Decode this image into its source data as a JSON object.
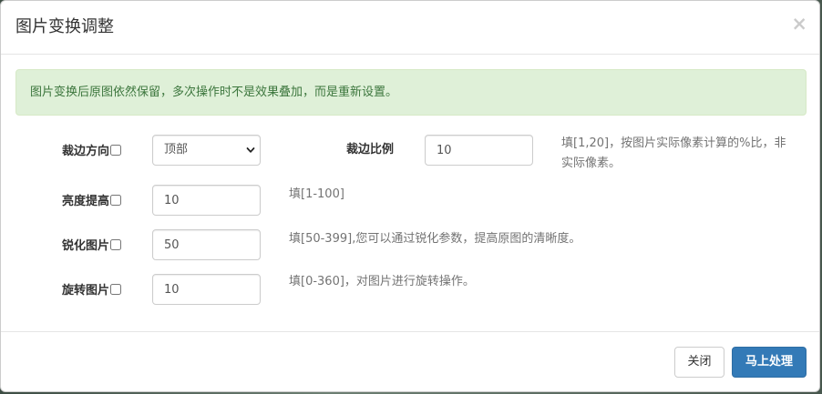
{
  "modal": {
    "title": "图片变换调整",
    "close_label": "×"
  },
  "alert": {
    "text": "图片变换后原图依然保留，多次操作时不是效果叠加，而是重新设置。"
  },
  "form": {
    "crop_direction": {
      "label": "裁边方向",
      "checked": false,
      "selected": "顶部"
    },
    "crop_ratio": {
      "label": "裁边比例",
      "value": "10",
      "help_line1": "填[1,20]，按图片实际像素计算的%比，非",
      "help_line2": "实际像素。"
    },
    "brightness": {
      "label": "亮度提高",
      "checked": false,
      "value": "10",
      "help": "填[1-100]"
    },
    "sharpen": {
      "label": "锐化图片",
      "checked": false,
      "value": "50",
      "help": "填[50-399],您可以通过锐化参数，提高原图的清晰度。"
    },
    "rotate": {
      "label": "旋转图片",
      "checked": false,
      "value": "10",
      "help": "填[0-360]，对图片进行旋转操作。"
    }
  },
  "footer": {
    "close_button": "关闭",
    "process_button": "马上处理"
  },
  "colors": {
    "primary": "#337ab7",
    "alert_bg": "#dff0d8",
    "alert_text": "#3c763d"
  }
}
